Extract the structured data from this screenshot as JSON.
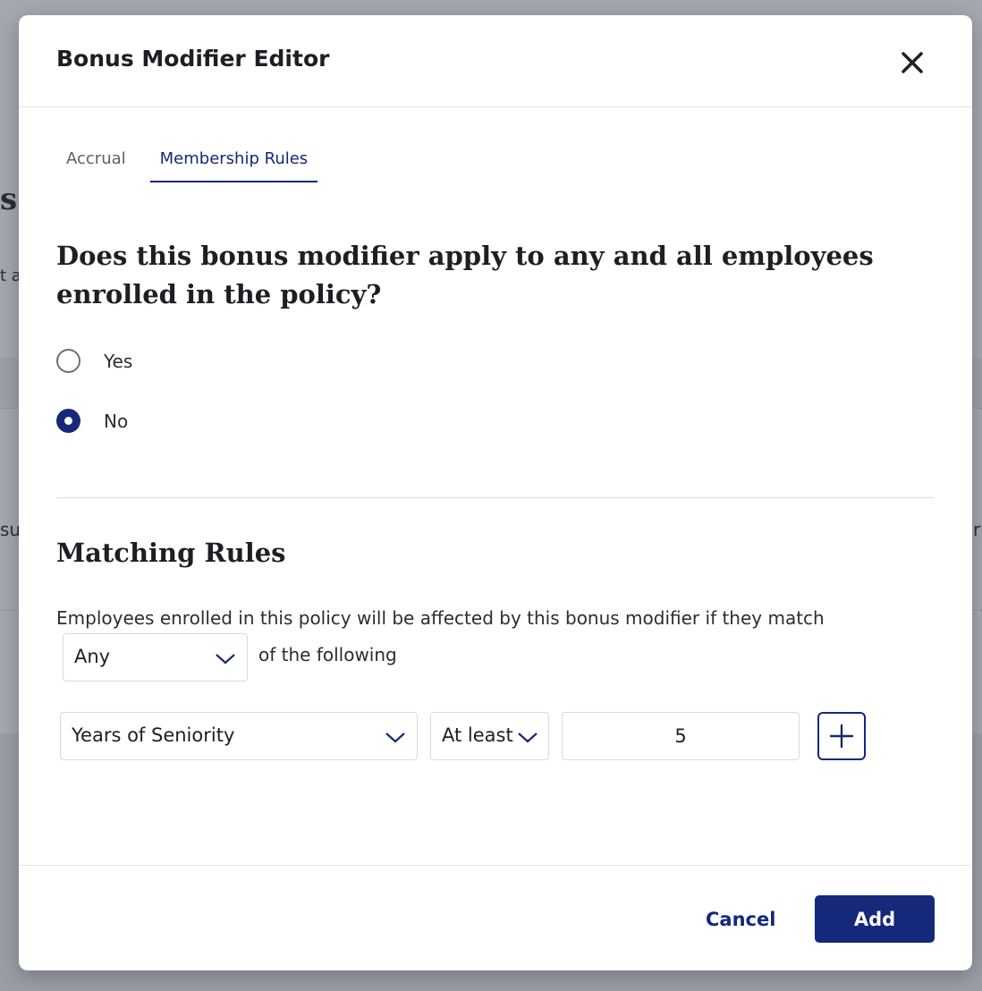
{
  "background": {
    "fragments": [
      "s",
      "t a",
      "su",
      "r"
    ]
  },
  "modal": {
    "title": "Bonus Modifier Editor",
    "close_icon": "close-icon"
  },
  "tabs": [
    {
      "label": "Accrual",
      "active": false
    },
    {
      "label": "Membership Rules",
      "active": true
    }
  ],
  "question": {
    "text": "Does this bonus modifier apply to any and all employees enrolled in the policy?",
    "options": [
      {
        "label": "Yes",
        "selected": false
      },
      {
        "label": "No",
        "selected": true
      }
    ]
  },
  "matching": {
    "title": "Matching Rules",
    "description": "Employees enrolled in this policy will be affected by this bonus modifier if they match",
    "match_select": "Any",
    "suffix": "of the following",
    "rule": {
      "field": "Years of Seniority",
      "operator": "At least",
      "value": "5"
    },
    "add_rule_icon": "plus-icon"
  },
  "footer": {
    "cancel_label": "Cancel",
    "add_label": "Add"
  },
  "colors": {
    "accent": "#15287a",
    "overlay": "#9a9ea6"
  }
}
